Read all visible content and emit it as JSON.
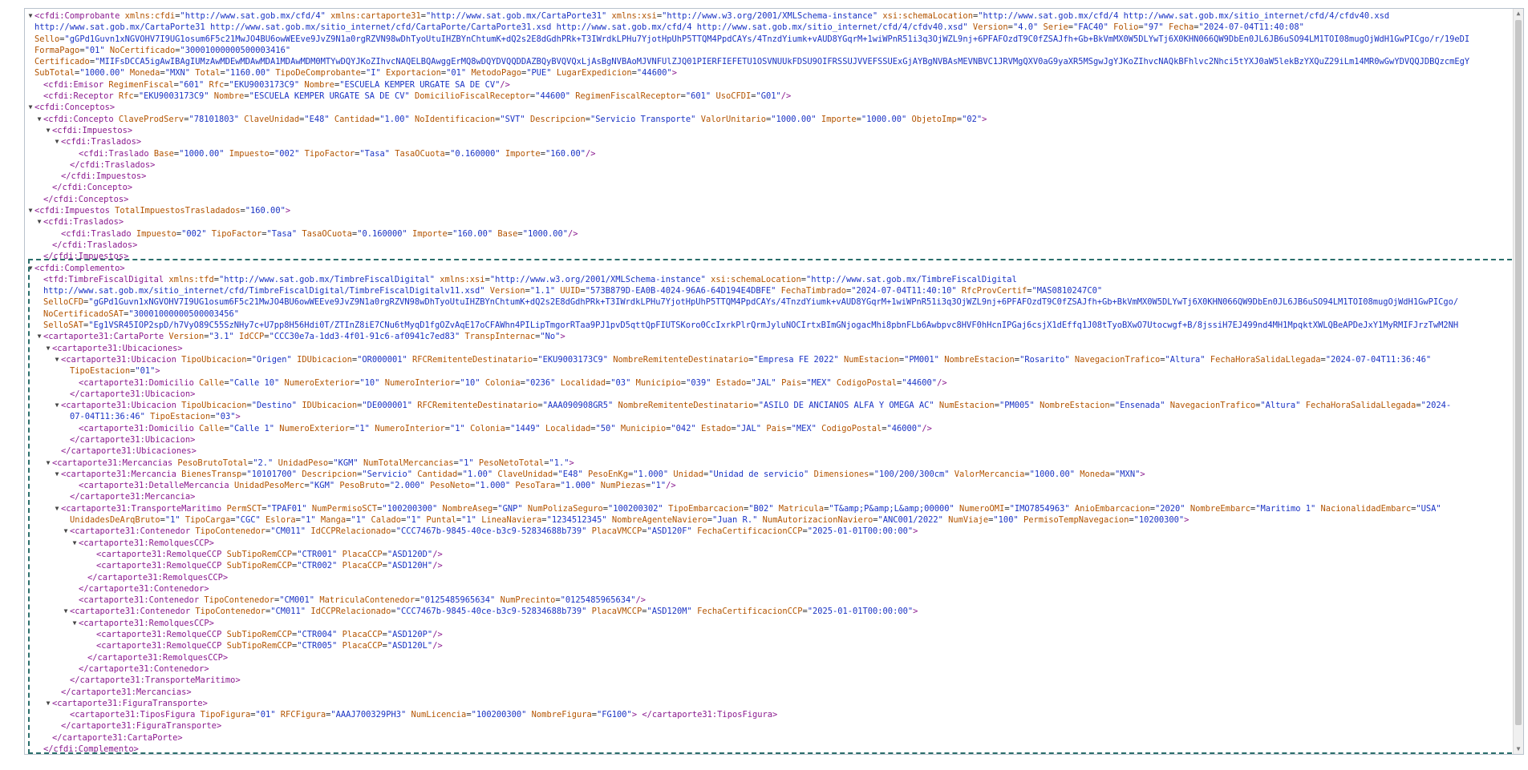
{
  "viewer_title": "XML document view",
  "lines": [
    {
      "d": 0,
      "t": "▼",
      "h": "<cfdi:Comprobante xmlns:cfdi=\"http://www.sat.gob.mx/cfd/4\" xmlns:cartaporte31=\"http://www.sat.gob.mx/CartaPorte31\" xmlns:xsi=\"http://www.w3.org/2001/XMLSchema-instance\" xsi:schemaLocation=\"http://www.sat.gob.mx/cfd/4 http://www.sat.gob.mx/sitio_internet/cfd/4/cfdv40.xsd"
    },
    {
      "d": 0,
      "t": "",
      "h": "http://www.sat.gob.mx/CartaPorte31 http://www.sat.gob.mx/sitio_internet/cfd/CartaPorte/CartaPorte31.xsd http://www.sat.gob.mx/cfd/4 http://www.sat.gob.mx/sitio_internet/cfd/4/cfdv40.xsd\" Version=\"4.0\" Serie=\"FAC40\" Folio=\"97\" Fecha=\"2024-07-04T11:40:08\""
    },
    {
      "d": 0,
      "t": "",
      "h": "Sello=\"gGPd1Guvn1xNGVOHV7I9UG1osum6F5c21MwJO4BU6owWEEve9JvZ9N1a0rgRZVN98wDhTyoUtuIHZBYnChtumK+dQ2s2E8dGdhPRk+T3IWrdkLPHu7YjotHpUhP5TTQM4PpdCAYs/4TnzdYiumk+vAUD8YGqrM+1wiWPnR51i3q3OjWZL9nj+6PFAFOzdT9C0fZSAJfh+Gb+BkVmMX0W5DLYwTj6X0KHN066QW9DbEn0JL6JB6uSO94LM1TOI08mugOjWdH1GwPICgo/r/19eDI"
    },
    {
      "d": 0,
      "t": "",
      "h": "FormaPago=\"01\" NoCertificado=\"30001000000500003416\""
    },
    {
      "d": 0,
      "t": "",
      "h": "Certificado=\"MIIFsDCCA5igAwIBAgIUMzAwMDEwMDAwMDA1MDAwMDM0MTYwDQYJKoZIhvcNAQELBQAwggErMQ8wDQYDVQQDDAZBQyBVQVQxLjAsBgNVBAoMJVNFUlZJQ01PIERFIEFETU1OSVNUUkFDSU9OIFRSSUJVVEFSSUExGjAYBgNVBAsMEVNBVC1JRVMgQXV0aG9yaXR5MSgwJgYJKoZIhvcNAQkBFhlvc2Nhci5tYXJ0aW5lekBzYXQuZ29iLm14MR0wGwYDVQQJDBQzcmEgY"
    },
    {
      "d": 0,
      "t": "",
      "h": "SubTotal=\"1000.00\" Moneda=\"MXN\" Total=\"1160.00\" TipoDeComprobante=\"I\" Exportacion=\"01\" MetodoPago=\"PUE\" LugarExpedicion=\"44600\">"
    },
    {
      "d": 1,
      "t": "",
      "h": "<cfdi:Emisor RegimenFiscal=\"601\" Rfc=\"EKU9003173C9\" Nombre=\"ESCUELA KEMPER URGATE SA DE CV\"/>"
    },
    {
      "d": 1,
      "t": "",
      "h": "<cfdi:Receptor Rfc=\"EKU9003173C9\" Nombre=\"ESCUELA KEMPER URGATE SA DE CV\" DomicilioFiscalReceptor=\"44600\" RegimenFiscalReceptor=\"601\" UsoCFDI=\"G01\"/>"
    },
    {
      "d": 0,
      "t": "▼",
      "h": "<cfdi:Conceptos>"
    },
    {
      "d": 1,
      "t": "▼",
      "h": "<cfdi:Concepto ClaveProdServ=\"78101803\" ClaveUnidad=\"E48\" Cantidad=\"1.00\" NoIdentificacion=\"SVT\" Descripcion=\"Servicio Transporte\" ValorUnitario=\"1000.00\" Importe=\"1000.00\" ObjetoImp=\"02\">"
    },
    {
      "d": 2,
      "t": "▼",
      "h": "<cfdi:Impuestos>"
    },
    {
      "d": 3,
      "t": "▼",
      "h": "<cfdi:Traslados>"
    },
    {
      "d": 5,
      "t": "",
      "h": "<cfdi:Traslado Base=\"1000.00\" Impuesto=\"002\" TipoFactor=\"Tasa\" TasaOCuota=\"0.160000\" Importe=\"160.00\"/>"
    },
    {
      "d": 4,
      "t": "",
      "h": "</cfdi:Traslados>"
    },
    {
      "d": 3,
      "t": "",
      "h": "</cfdi:Impuestos>"
    },
    {
      "d": 2,
      "t": "",
      "h": "</cfdi:Concepto>"
    },
    {
      "d": 1,
      "t": "",
      "h": "</cfdi:Conceptos>"
    },
    {
      "d": 0,
      "t": "▼",
      "h": "<cfdi:Impuestos TotalImpuestosTrasladados=\"160.00\">"
    },
    {
      "d": 1,
      "t": "▼",
      "h": "<cfdi:Traslados>"
    },
    {
      "d": 3,
      "t": "",
      "h": "<cfdi:Traslado Impuesto=\"002\" TipoFactor=\"Tasa\" TasaOCuota=\"0.160000\" Importe=\"160.00\" Base=\"1000.00\"/>"
    },
    {
      "d": 2,
      "t": "",
      "h": "</cfdi:Traslados>"
    },
    {
      "d": 1,
      "t": "",
      "h": "</cfdi:Impuestos>"
    },
    {
      "d": 0,
      "t": "▼",
      "h": "<cfdi:Complemento>"
    },
    {
      "d": 1,
      "t": "",
      "h": "<tfd:TimbreFiscalDigital xmlns:tfd=\"http://www.sat.gob.mx/TimbreFiscalDigital\" xmlns:xsi=\"http://www.w3.org/2001/XMLSchema-instance\" xsi:schemaLocation=\"http://www.sat.gob.mx/TimbreFiscalDigital"
    },
    {
      "d": 1,
      "t": "",
      "h": "http://www.sat.gob.mx/sitio_internet/cfd/TimbreFiscalDigital/TimbreFiscalDigitalv11.xsd\" Version=\"1.1\" UUID=\"573B879D-EA0B-4024-96A6-64D194E4DBFE\" FechaTimbrado=\"2024-07-04T11:40:10\" RfcProvCertif=\"MAS0810247C0\""
    },
    {
      "d": 1,
      "t": "",
      "h": "SelloCFD=\"gGPd1Guvn1xNGVOHV7I9UG1osum6F5c21MwJO4BU6owWEEve9JvZ9N1a0rgRZVN98wDhTyoUtuIHZBYnChtumK+dQ2s2E8dGdhPRk+T3IWrdkLPHu7YjotHpUhP5TTQM4PpdCAYs/4TnzdYiumk+vAUD8YGqrM+1wiWPnR51i3q3OjWZL9nj+6PFAFOzdT9C0fZSAJfh+Gb+BkVmMX0W5DLYwTj6X0KHN066QW9DbEn0JL6JB6uSO94LM1TOI08mugOjWdH1GwPICgo/"
    },
    {
      "d": 1,
      "t": "",
      "h": "NoCertificadoSAT=\"30001000000500003456\""
    },
    {
      "d": 1,
      "t": "",
      "h": "SelloSAT=\"Eg1VSR45IOP2spD/h7VyO89C55SzNHy7c+U7pp8H56Hdi0T/ZTInZ8iE7CNu6tMyqD1fgOZvAqE17oCFAWhn4PILipTmgorRTaa9PJ1pvD5qttQpFIUTSKoro0CcIxrkPlrQrmJyluNOCIrtxBImGNjogacMhi8pbnFLb6Awbpvc8HVF0hHcnIPGaj6csjX1dEffq1J08tTyoBXwO7Utocwgf+B/8jssiH7EJ499nd4MH1MpqktXWLQBeAPDeJxY1MyRMIFJrzTwM2NH"
    },
    {
      "d": 1,
      "t": "▼",
      "h": "<cartaporte31:CartaPorte Version=\"3.1\" IdCCP=\"CCC30e7a-1dd3-4f01-91c6-af0941c7ed83\" TranspInternac=\"No\">"
    },
    {
      "d": 2,
      "t": "▼",
      "h": "<cartaporte31:Ubicaciones>"
    },
    {
      "d": 3,
      "t": "▼",
      "h": "<cartaporte31:Ubicacion TipoUbicacion=\"Origen\" IDUbicacion=\"OR000001\" RFCRemitenteDestinatario=\"EKU9003173C9\" NombreRemitenteDestinatario=\"Empresa FE 2022\" NumEstacion=\"PM001\" NombreEstacion=\"Rosarito\" NavegacionTrafico=\"Altura\" FechaHoraSalidaLlegada=\"2024-07-04T11:36:46\""
    },
    {
      "d": 4,
      "t": "",
      "h": "TipoEstacion=\"01\">"
    },
    {
      "d": 5,
      "t": "",
      "h": "<cartaporte31:Domicilio Calle=\"Calle 10\" NumeroExterior=\"10\" NumeroInterior=\"10\" Colonia=\"0236\" Localidad=\"03\" Municipio=\"039\" Estado=\"JAL\" Pais=\"MEX\" CodigoPostal=\"44600\"/>"
    },
    {
      "d": 4,
      "t": "",
      "h": "</cartaporte31:Ubicacion>"
    },
    {
      "d": 3,
      "t": "▼",
      "h": "<cartaporte31:Ubicacion TipoUbicacion=\"Destino\" IDUbicacion=\"DE000001\" RFCRemitenteDestinatario=\"AAA090908GR5\" NombreRemitenteDestinatario=\"ASILO DE ANCIANOS ALFA Y OMEGA AC\" NumEstacion=\"PM005\" NombreEstacion=\"Ensenada\" NavegacionTrafico=\"Altura\" FechaHoraSalidaLlegada=\"2024-"
    },
    {
      "d": 4,
      "t": "",
      "h": "07-04T11:36:46\" TipoEstacion=\"03\">"
    },
    {
      "d": 5,
      "t": "",
      "h": "<cartaporte31:Domicilio Calle=\"Calle 1\" NumeroExterior=\"1\" NumeroInterior=\"1\" Colonia=\"1449\" Localidad=\"50\" Municipio=\"042\" Estado=\"JAL\" Pais=\"MEX\" CodigoPostal=\"46000\"/>"
    },
    {
      "d": 4,
      "t": "",
      "h": "</cartaporte31:Ubicacion>"
    },
    {
      "d": 3,
      "t": "",
      "h": "</cartaporte31:Ubicaciones>"
    },
    {
      "d": 2,
      "t": "▼",
      "h": "<cartaporte31:Mercancias PesoBrutoTotal=\"2.\" UnidadPeso=\"KGM\" NumTotalMercancias=\"1\" PesoNetoTotal=\"1.\">"
    },
    {
      "d": 3,
      "t": "▼",
      "h": "<cartaporte31:Mercancia BienesTransp=\"10101700\" Descripcion=\"Servicio\" Cantidad=\"1.00\" ClaveUnidad=\"E48\" PesoEnKg=\"1.000\" Unidad=\"Unidad de servicio\" Dimensiones=\"100/200/300cm\" ValorMercancia=\"1000.00\" Moneda=\"MXN\">"
    },
    {
      "d": 5,
      "t": "",
      "h": "<cartaporte31:DetalleMercancia UnidadPesoMerc=\"KGM\" PesoBruto=\"2.000\" PesoNeto=\"1.000\" PesoTara=\"1.000\" NumPiezas=\"1\"/>"
    },
    {
      "d": 4,
      "t": "",
      "h": "</cartaporte31:Mercancia>"
    },
    {
      "d": 3,
      "t": "▼",
      "h": "<cartaporte31:TransporteMaritimo PermSCT=\"TPAF01\" NumPermisoSCT=\"100200300\" NombreAseg=\"GNP\" NumPolizaSeguro=\"100200302\" TipoEmbarcacion=\"B02\" Matricula=\"T&amp;P&amp;L&amp;00000\" NumeroOMI=\"IMO7854963\" AnioEmbarcacion=\"2020\" NombreEmbarc=\"Maritimo 1\" NacionalidadEmbarc=\"USA\""
    },
    {
      "d": 4,
      "t": "",
      "h": "UnidadesDeArqBruto=\"1\" TipoCarga=\"CGC\" Eslora=\"1\" Manga=\"1\" Calado=\"1\" Puntal=\"1\" LineaNaviera=\"1234512345\" NombreAgenteNaviero=\"Juan R.\" NumAutorizacionNaviero=\"ANC001/2022\" NumViaje=\"100\" PermisoTempNavegacion=\"10200300\">"
    },
    {
      "d": 4,
      "t": "▼",
      "h": "<cartaporte31:Contenedor TipoContenedor=\"CM011\" IdCCPRelacionado=\"CCC7467b-9845-40ce-b3c9-52834688b739\" PlacaVMCCP=\"ASD120F\" FechaCertificacionCCP=\"2025-01-01T00:00:00\">"
    },
    {
      "d": 5,
      "t": "▼",
      "h": "<cartaporte31:RemolquesCCP>"
    },
    {
      "d": 7,
      "t": "",
      "h": "<cartaporte31:RemolqueCCP SubTipoRemCCP=\"CTR001\" PlacaCCP=\"ASD120D\"/>"
    },
    {
      "d": 7,
      "t": "",
      "h": "<cartaporte31:RemolqueCCP SubTipoRemCCP=\"CTR002\" PlacaCCP=\"ASD120H\"/>"
    },
    {
      "d": 6,
      "t": "",
      "h": "</cartaporte31:RemolquesCCP>"
    },
    {
      "d": 5,
      "t": "",
      "h": "</cartaporte31:Contenedor>"
    },
    {
      "d": 5,
      "t": "",
      "h": "<cartaporte31:Contenedor TipoContenedor=\"CM001\" MatriculaContenedor=\"0125485965634\" NumPrecinto=\"0125485965634\"/>"
    },
    {
      "d": 4,
      "t": "▼",
      "h": "<cartaporte31:Contenedor TipoContenedor=\"CM011\" IdCCPRelacionado=\"CCC7467b-9845-40ce-b3c9-52834688b739\" PlacaVMCCP=\"ASD120M\" FechaCertificacionCCP=\"2025-01-01T00:00:00\">"
    },
    {
      "d": 5,
      "t": "▼",
      "h": "<cartaporte31:RemolquesCCP>"
    },
    {
      "d": 7,
      "t": "",
      "h": "<cartaporte31:RemolqueCCP SubTipoRemCCP=\"CTR004\" PlacaCCP=\"ASD120P\"/>"
    },
    {
      "d": 7,
      "t": "",
      "h": "<cartaporte31:RemolqueCCP SubTipoRemCCP=\"CTR005\" PlacaCCP=\"ASD120L\"/>"
    },
    {
      "d": 6,
      "t": "",
      "h": "</cartaporte31:RemolquesCCP>"
    },
    {
      "d": 5,
      "t": "",
      "h": "</cartaporte31:Contenedor>"
    },
    {
      "d": 4,
      "t": "",
      "h": "</cartaporte31:TransporteMaritimo>"
    },
    {
      "d": 3,
      "t": "",
      "h": "</cartaporte31:Mercancias>"
    },
    {
      "d": 2,
      "t": "▼",
      "h": "<cartaporte31:FiguraTransporte>"
    },
    {
      "d": 4,
      "t": "",
      "h": "<cartaporte31:TiposFigura TipoFigura=\"01\" RFCFigura=\"AAAJ700329PH3\" NumLicencia=\"100200300\" NombreFigura=\"FG100\"> </cartaporte31:TiposFigura>"
    },
    {
      "d": 3,
      "t": "",
      "h": "</cartaporte31:FiguraTransporte>"
    },
    {
      "d": 2,
      "t": "",
      "h": "</cartaporte31:CartaPorte>"
    },
    {
      "d": 1,
      "t": "",
      "h": "</cfdi:Complemento>"
    },
    {
      "d": 0,
      "t": "",
      "h": "</cfdi:Comprobante>"
    }
  ]
}
